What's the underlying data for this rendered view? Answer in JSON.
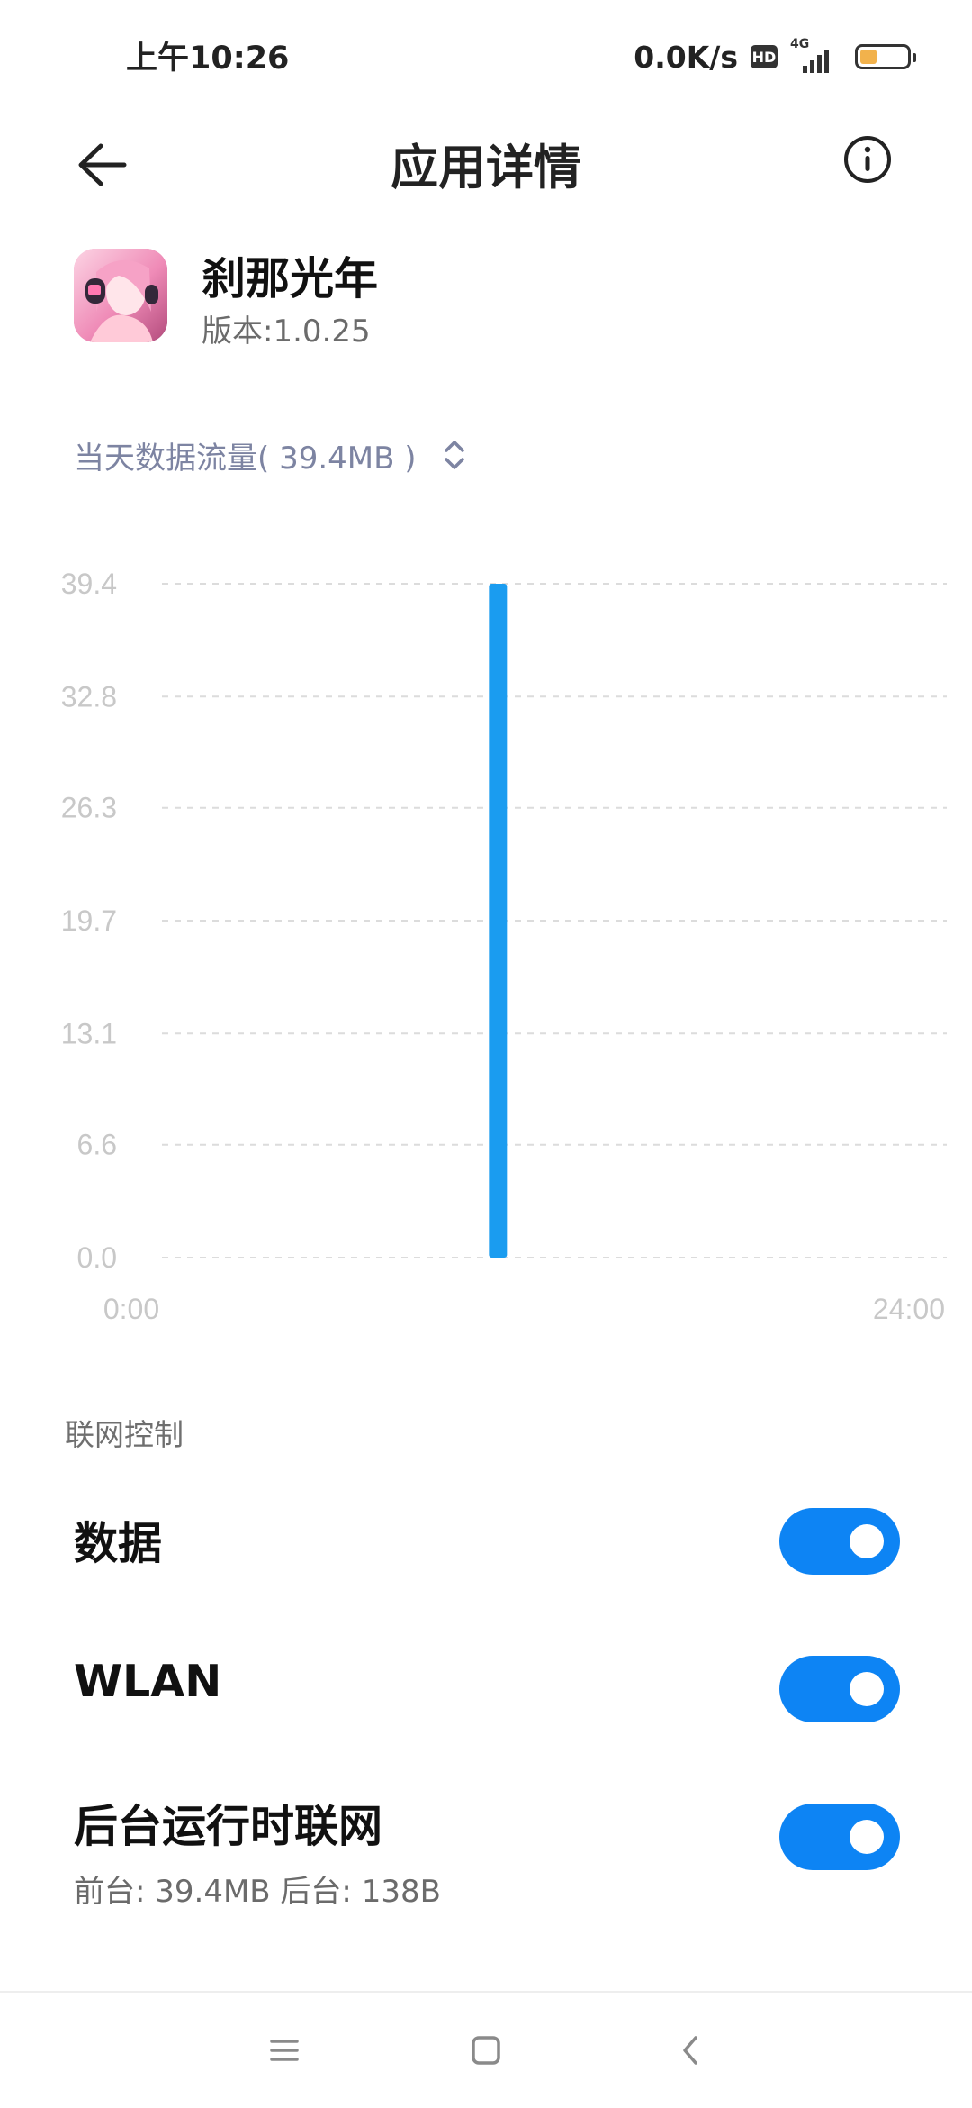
{
  "status_bar": {
    "time": "上午10:26",
    "network_speed": "0.0K/s",
    "hd_badge": "HD",
    "signal_label": "4G",
    "battery_level": 0.35,
    "battery_color": "#f2b24c"
  },
  "header": {
    "title": "应用详情",
    "back_icon": "arrow-left-icon",
    "info_icon": "info-circle-icon"
  },
  "app": {
    "name": "刹那光年",
    "version": "版本:1.0.25"
  },
  "usage": {
    "label": "当天数据流量( 39.4MB )",
    "selector_icon": "chevron-up-down-icon"
  },
  "chart_data": {
    "type": "bar",
    "x": [
      "0:00",
      "24:00"
    ],
    "xlabels": [
      "0:00",
      "24:00"
    ],
    "yticks": [
      "39.4",
      "32.8",
      "26.3",
      "19.7",
      "13.1",
      "6.6",
      "0.0"
    ],
    "ylim": [
      0,
      39.4
    ],
    "series": [
      {
        "values": [
          {
            "x": "10:00",
            "y": 39.4
          }
        ]
      }
    ],
    "bar_color": "#1a9cf0",
    "grid": true
  },
  "network_control": {
    "section_title": "联网控制",
    "rows": [
      {
        "label": "数据",
        "enabled": true
      },
      {
        "label": "WLAN",
        "enabled": true
      },
      {
        "label": "后台运行时联网",
        "subtitle": "前台: 39.4MB  后台: 138B",
        "enabled": true
      }
    ],
    "accent_color": "#0d84f4"
  },
  "navigation": {
    "menu_icon": "menu-icon",
    "home_icon": "home-icon",
    "back_icon": "back-icon"
  }
}
